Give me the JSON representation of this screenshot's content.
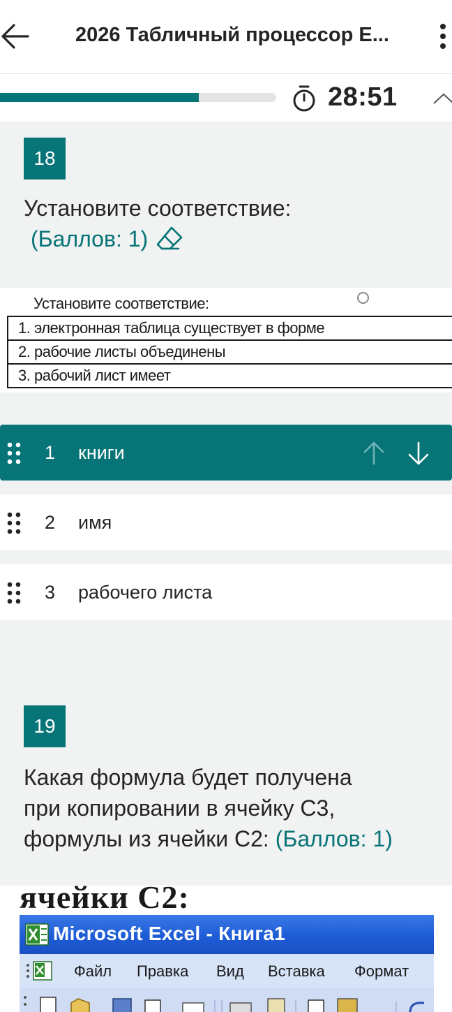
{
  "header": {
    "title": "2026 Табличный процессор  E..."
  },
  "progress": {
    "fraction": 0.72,
    "timer": "28:51"
  },
  "question18": {
    "number": "18",
    "title": "Установите соответствие:",
    "points": "(Баллов: 1)",
    "image": {
      "caption": "Установите соответствие:",
      "rows": [
        "1. электронная таблица существует в форме",
        "2. рабочие листы объединены",
        "3. рабочий лист имеет"
      ]
    },
    "items": [
      {
        "num": "1",
        "label": "книги"
      },
      {
        "num": "2",
        "label": "имя"
      },
      {
        "num": "3",
        "label": "рабочего листа"
      }
    ]
  },
  "question19": {
    "number": "19",
    "title_line1": "Какая формула будет получена",
    "title_line2": "при копировании в ячейку С3,",
    "title_line3": "формулы из ячейки С2:",
    "points": "(Баллов: 1)",
    "image": {
      "heading": "ячейки С2:",
      "window_title": "Microsoft Excel - Книга1",
      "menu": [
        "Файл",
        "Правка",
        "Вид",
        "Вставка",
        "Формат"
      ]
    }
  },
  "colors": {
    "accent": "#077477",
    "section_bg": "#f1f2f2"
  },
  "icons": {
    "back": "arrow-left-icon",
    "more": "kebab-icon",
    "timer": "stopwatch-icon",
    "collapse": "chevron-up-icon",
    "eraser": "eraser-icon",
    "grip": "drag-handle-icon",
    "up": "arrow-up-icon",
    "down": "arrow-down-icon"
  }
}
